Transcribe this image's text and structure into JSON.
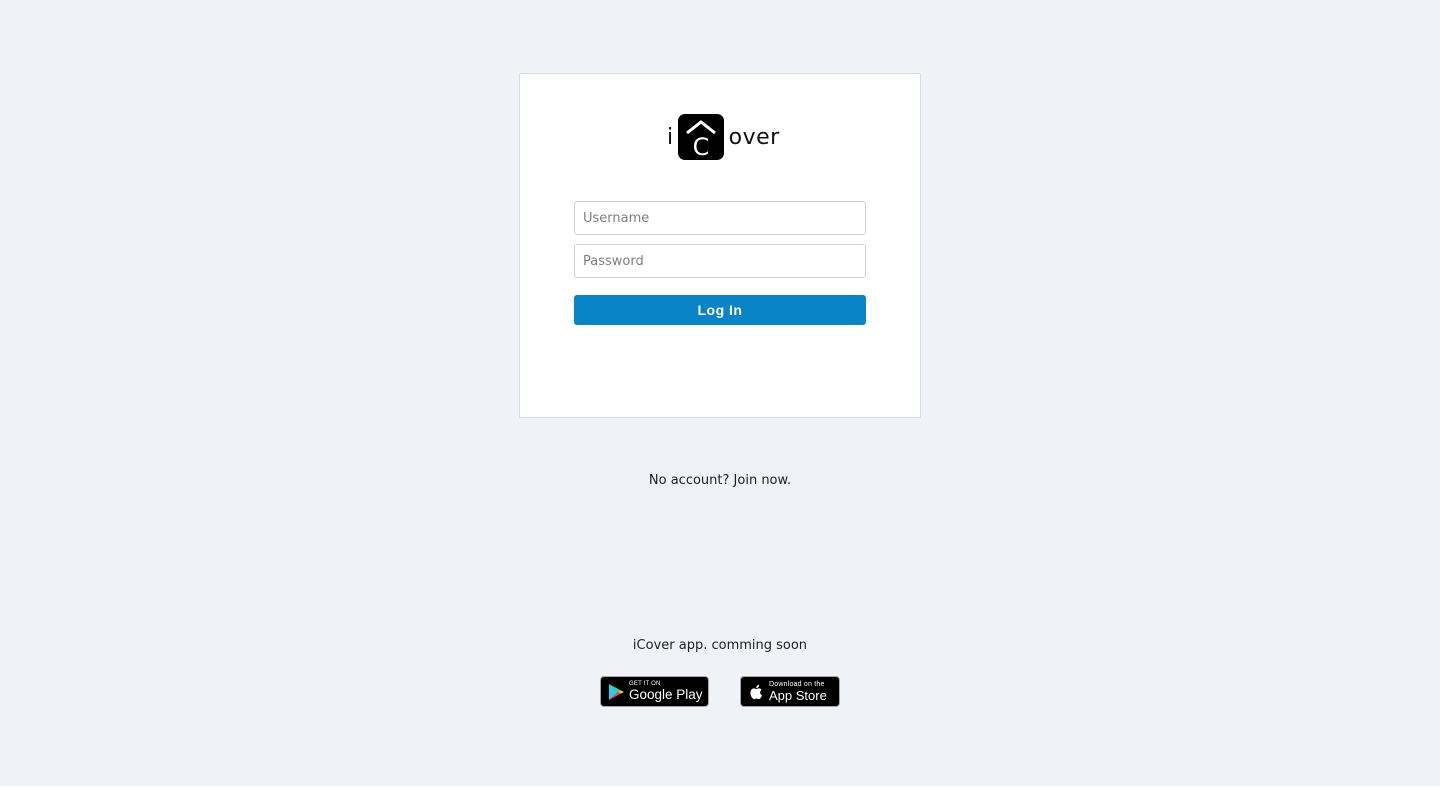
{
  "brand": {
    "prefix": "i",
    "mark_letter": "C",
    "suffix": "over",
    "icon": "house-c-logo-icon"
  },
  "login_form": {
    "username_placeholder": "Username",
    "password_placeholder": "Password",
    "login_label": "Log In"
  },
  "signup": {
    "prompt": "No account?",
    "link_label": "Join now."
  },
  "app_promo": {
    "text": "iCover app. comming soon",
    "google_play": {
      "small": "GET IT ON",
      "big": "Google Play",
      "icon": "google-play-icon"
    },
    "app_store": {
      "small": "Download on the",
      "big": "App Store",
      "icon": "apple-icon"
    }
  },
  "colors": {
    "background": "#eff2f7",
    "primary_button": "#0a84c6",
    "card": "#ffffff"
  }
}
